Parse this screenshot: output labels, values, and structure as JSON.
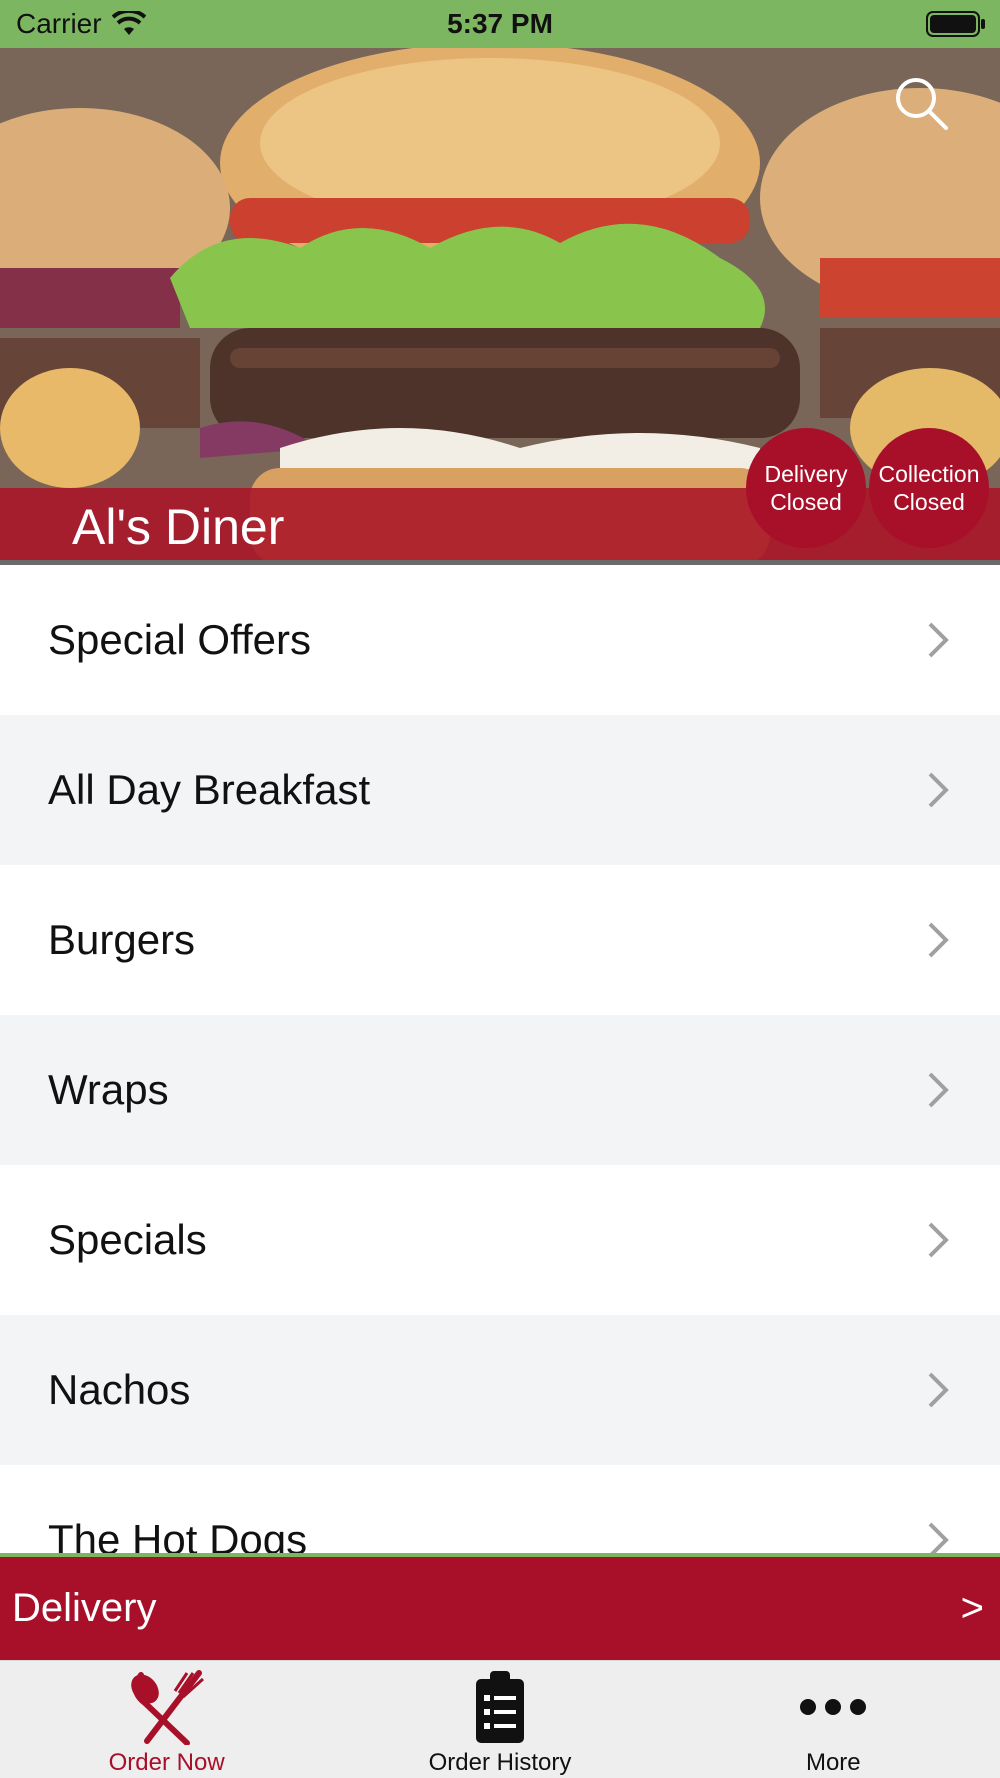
{
  "status_bar": {
    "carrier": "Carrier",
    "time": "5:37 PM"
  },
  "restaurant": {
    "name": "Al's Diner"
  },
  "badges": {
    "delivery": {
      "line1": "Delivery",
      "line2": "Closed"
    },
    "collection": {
      "line1": "Collection",
      "line2": "Closed"
    }
  },
  "menu": {
    "items": [
      {
        "label": "Special Offers"
      },
      {
        "label": "All Day Breakfast"
      },
      {
        "label": "Burgers"
      },
      {
        "label": "Wraps"
      },
      {
        "label": "Specials"
      },
      {
        "label": "Nachos"
      },
      {
        "label": "The Hot Dogs"
      }
    ]
  },
  "order_type": {
    "label": "Delivery",
    "arrow": ">"
  },
  "tabs": {
    "order_now": "Order Now",
    "order_history": "Order History",
    "more": "More"
  },
  "colors": {
    "brand": "#a8102a",
    "status_bar": "#7db661"
  },
  "icons": [
    "wifi-icon",
    "battery-icon",
    "search-icon",
    "chevron-right-icon",
    "fork-knife-icon",
    "clipboard-icon",
    "more-dots-icon"
  ]
}
